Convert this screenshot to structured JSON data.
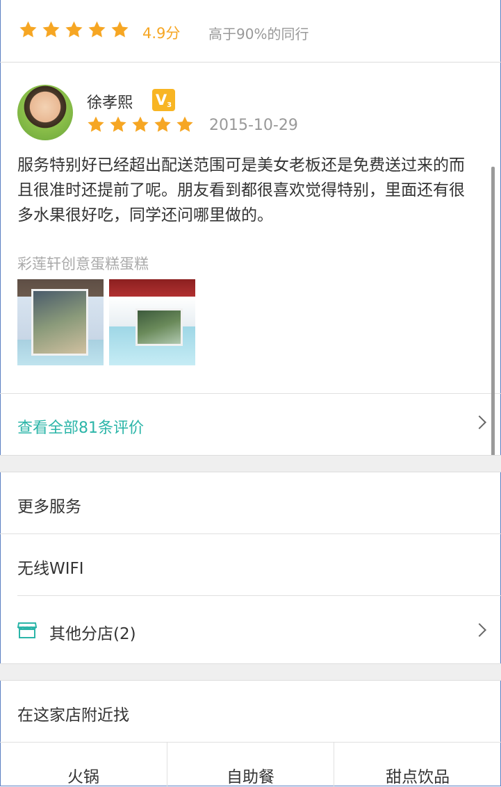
{
  "rating": {
    "stars": 5,
    "score": "4.9分",
    "compare": "高于90%的同行"
  },
  "review": {
    "username": "徐孝熙",
    "vip_level": "3",
    "stars": 5,
    "date": "2015-10-29",
    "text": "服务特别好已经超出配送范围可是美女老板还是免费送过来的而且很准时还提前了呢。朋友看到都很喜欢觉得特别，里面还有很多水果很好吃，同学还问哪里做的。",
    "shop_tag": "彩莲轩创意蛋糕蛋糕"
  },
  "view_all": {
    "label": "查看全部81条评价"
  },
  "more_services": {
    "title": "更多服务"
  },
  "wifi": {
    "label": "无线WIFI"
  },
  "branches": {
    "label": "其他分店(2)",
    "icon": "store-icon"
  },
  "nearby": {
    "title": "在这家店附近找",
    "categories": [
      "火锅",
      "自助餐",
      "甜点饮品"
    ]
  },
  "colors": {
    "star": "#f6a623",
    "accent": "#2bb5a8",
    "vip": "#f8b523"
  }
}
